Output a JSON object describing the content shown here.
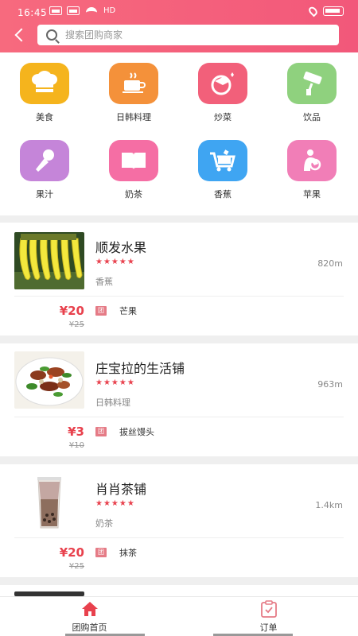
{
  "status_bar": {
    "time": "16:45",
    "network": "HD"
  },
  "search": {
    "placeholder": "搜索团购商家"
  },
  "categories": [
    {
      "label": "美食",
      "icon": "chef-hat-icon",
      "color": "#f5b41d"
    },
    {
      "label": "日韩料理",
      "icon": "coffee-cup-icon",
      "color": "#f4913a"
    },
    {
      "label": "炒菜",
      "icon": "graduation-cap-icon",
      "color": "#f2607a"
    },
    {
      "label": "饮品",
      "icon": "paint-roller-icon",
      "color": "#8fd17e"
    },
    {
      "label": "果汁",
      "icon": "microphone-icon",
      "color": "#c585d9"
    },
    {
      "label": "奶茶",
      "icon": "book-icon",
      "color": "#f56ea4"
    },
    {
      "label": "香蕉",
      "icon": "shopping-cart-icon",
      "color": "#3fa5f2"
    },
    {
      "label": "苹果",
      "icon": "mother-baby-icon",
      "color": "#f17eb7"
    }
  ],
  "shops": [
    {
      "name": "顺发水果",
      "rating_stars": "★★★★★",
      "rating": 5,
      "category": "香蕉",
      "distance": "820m",
      "price": "¥20",
      "original_price": "¥25",
      "deal_badge": "团",
      "deal_name": "芒果"
    },
    {
      "name": "庄宝拉的生活铺",
      "rating_stars": "★★★★★",
      "rating": 5,
      "category": "日韩料理",
      "distance": "963m",
      "price": "¥3",
      "original_price": "¥10",
      "deal_badge": "团",
      "deal_name": "拔丝馒头"
    },
    {
      "name": "肖肖茶铺",
      "rating_stars": "★★★★★",
      "rating": 5,
      "category": "奶茶",
      "distance": "1.4km",
      "price": "¥20",
      "original_price": "¥25",
      "deal_badge": "团",
      "deal_name": "抹茶"
    }
  ],
  "bottom_nav": [
    {
      "label": "团购首页",
      "icon": "home-icon",
      "active": true
    },
    {
      "label": "订单",
      "icon": "clipboard-icon",
      "active": false
    }
  ],
  "colors": {
    "header": "#f2587a",
    "price": "#e8414d",
    "star": "#e8424e"
  }
}
